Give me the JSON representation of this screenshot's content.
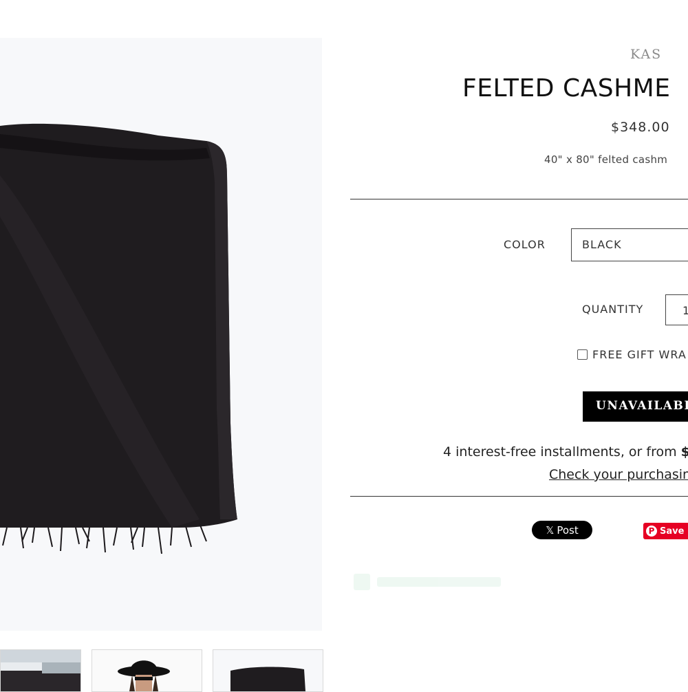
{
  "product": {
    "vendor": "KAS",
    "title": "FELTED CASHME",
    "price": "$348.00",
    "description": "40\" x 80\" felted cashm"
  },
  "options": {
    "color_label": "COLOR",
    "color_value": "BLACK",
    "quantity_label": "QUANTITY",
    "quantity_value": "1",
    "gift_wrap_label": "FREE GIFT WRA"
  },
  "actions": {
    "unavailable_label": "UNAVAILABL",
    "installments_text": "4 interest-free installments, or from ",
    "installments_amount": "$",
    "check_link": "Check your purchasin"
  },
  "social": {
    "post_label": "Post",
    "post_icon": "x-logo-icon",
    "save_label": "Save",
    "save_icon": "pinterest-icon"
  },
  "colors": {
    "button_black": "#000000",
    "pinterest_red": "#e60023",
    "vendor_gray": "#8a8a8a"
  }
}
